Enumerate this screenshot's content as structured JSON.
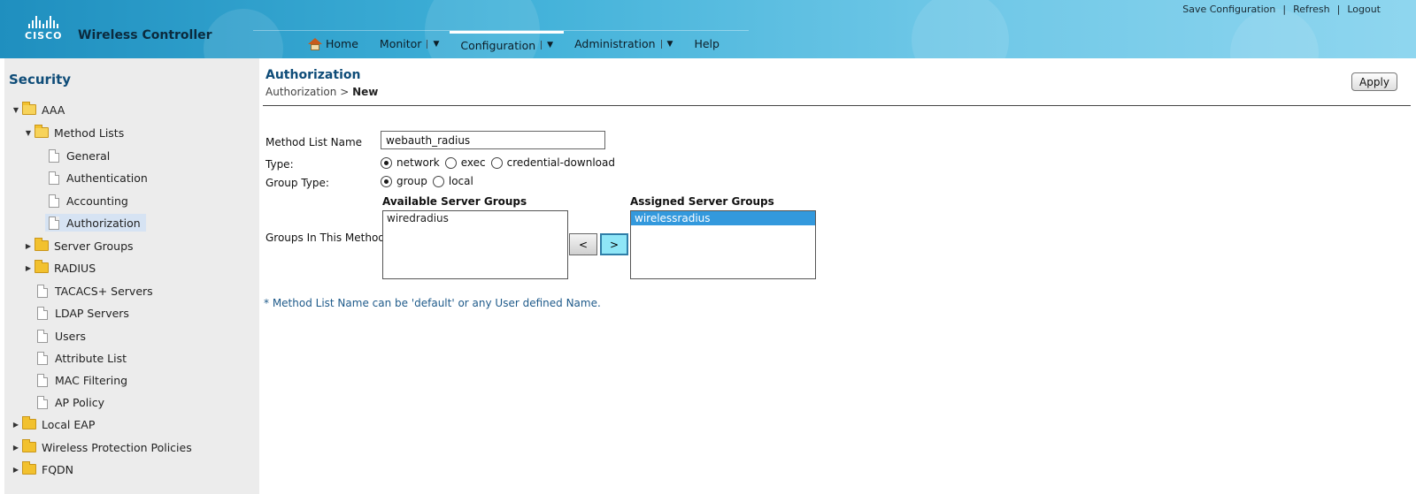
{
  "header": {
    "logo_text": "CISCO",
    "product": "Wireless Controller",
    "top_links": [
      "Save Configuration",
      "Refresh",
      "Logout"
    ],
    "separator": "|",
    "nav": [
      {
        "label": "Home"
      },
      {
        "label": "Monitor"
      },
      {
        "label": "Configuration"
      },
      {
        "label": "Administration"
      },
      {
        "label": "Help"
      }
    ],
    "dropdown_glyph": "▼"
  },
  "sidebar": {
    "title": "Security",
    "items": [
      {
        "label": "AAA"
      },
      {
        "label": "Method Lists"
      },
      {
        "label": "General"
      },
      {
        "label": "Authentication"
      },
      {
        "label": "Accounting"
      },
      {
        "label": "Authorization"
      },
      {
        "label": "Server Groups"
      },
      {
        "label": "RADIUS"
      },
      {
        "label": "TACACS+ Servers"
      },
      {
        "label": "LDAP Servers"
      },
      {
        "label": "Users"
      },
      {
        "label": "Attribute List"
      },
      {
        "label": "MAC Filtering"
      },
      {
        "label": "AP Policy"
      },
      {
        "label": "Local EAP"
      },
      {
        "label": "Wireless Protection Policies"
      },
      {
        "label": "FQDN"
      }
    ]
  },
  "content": {
    "title": "Authorization",
    "breadcrumb_parent": "Authorization >",
    "breadcrumb_current": "New",
    "apply_label": "Apply",
    "form": {
      "method_list_name_label": "Method List Name",
      "method_list_name_value": "webauth_radius",
      "type_label": "Type:",
      "type_options": [
        "network",
        "exec",
        "credential-download"
      ],
      "group_type_label": "Group Type:",
      "group_type_options": [
        "group",
        "local"
      ],
      "groups_label": "Groups In This Method",
      "available_heading": "Available Server Groups",
      "available_items": [
        "wiredradius"
      ],
      "assigned_heading": "Assigned Server Groups",
      "assigned_items": [
        "wirelessradius"
      ],
      "move_left": "<",
      "move_right": ">"
    },
    "footnote": "* Method List Name can be 'default' or any User defined Name."
  }
}
